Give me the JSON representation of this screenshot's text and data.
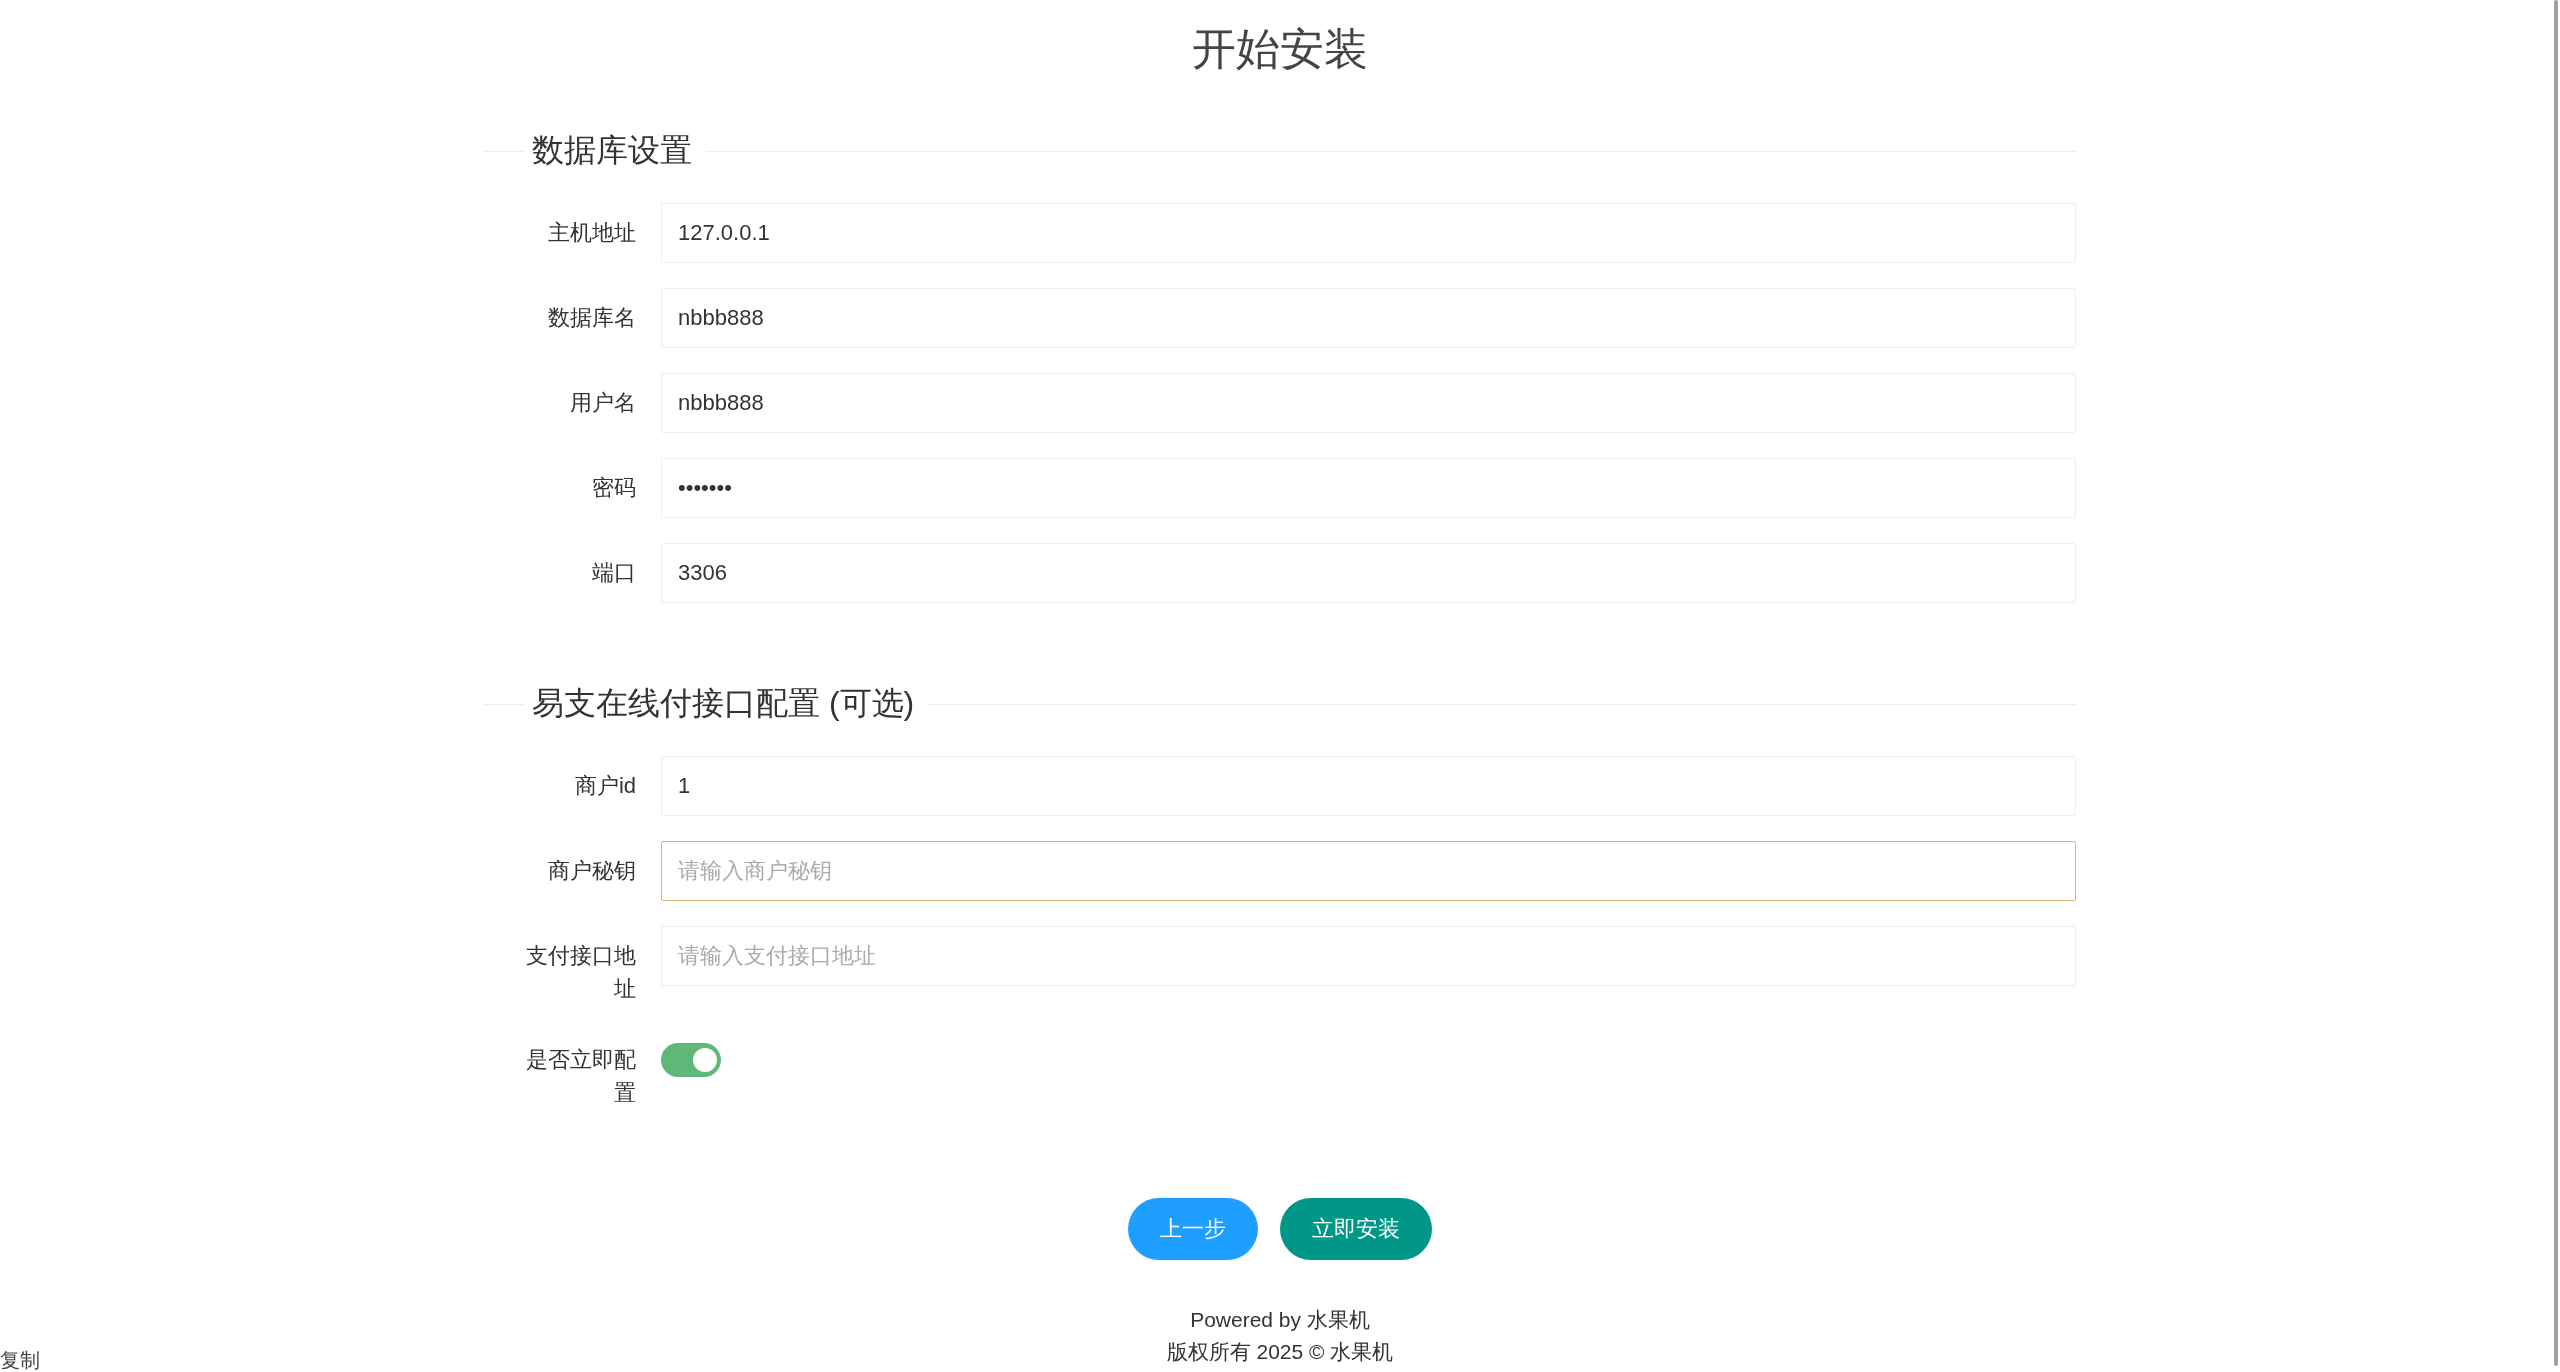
{
  "title": "开始安装",
  "sections": [
    {
      "legend": "数据库设置",
      "fields": [
        {
          "kind": "text",
          "label": "主机地址",
          "value": "127.0.0.1",
          "focused": false
        },
        {
          "kind": "text",
          "label": "数据库名",
          "value": "nbbb888",
          "focused": false
        },
        {
          "kind": "text",
          "label": "用户名",
          "value": "nbbb888",
          "focused": false
        },
        {
          "kind": "text",
          "label": "密码",
          "value": "•••••••",
          "focused": false
        },
        {
          "kind": "text",
          "label": "端口",
          "value": "3306",
          "focused": false
        }
      ]
    },
    {
      "legend": "易支在线付接口配置 (可选)",
      "fields": [
        {
          "kind": "text",
          "label": "商户id",
          "value": "1",
          "focused": false
        },
        {
          "kind": "text",
          "label": "商户秘钥",
          "placeholder": "请输入商户秘钥",
          "focused": true
        },
        {
          "kind": "text",
          "label": "支付接口地址",
          "placeholder": "请输入支付接口地址",
          "focused": false
        },
        {
          "kind": "toggle",
          "label": "是否立即配置",
          "on": true
        }
      ]
    }
  ],
  "buttons": [
    {
      "kind": "secondary",
      "label": "上一步"
    },
    {
      "kind": "primary",
      "label": "立即安装"
    }
  ],
  "footer": [
    "Powered by 水果机",
    "版权所有 2025 © 水果机"
  ],
  "corner_text": "复制"
}
